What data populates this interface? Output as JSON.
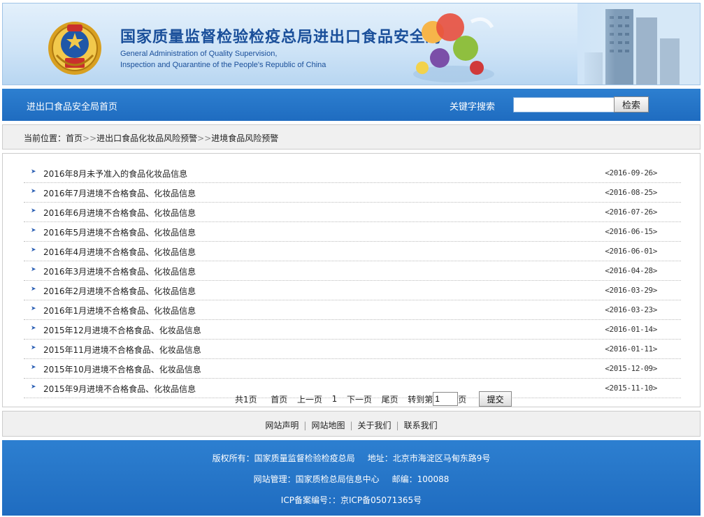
{
  "header": {
    "title": "国家质量监督检验检疫总局进出口食品安全局",
    "subtitle_en_1": "General Administration of Quality Supervision,",
    "subtitle_en_2": "Inspection and Quarantine of the People's Republic of China"
  },
  "nav": {
    "home_label": "进出口食品安全局首页",
    "search_label": "关键字搜索",
    "search_value": "",
    "search_button": "检索"
  },
  "breadcrumb": {
    "prefix": "当前位置：",
    "items": [
      "首页",
      "进出口食品化妆品风险预警",
      "进境食品风险预警"
    ],
    "separator": ">>"
  },
  "news": [
    {
      "title": "2016年8月未予准入的食品化妆品信息",
      "date": "<2016-09-26>"
    },
    {
      "title": "2016年7月进境不合格食品、化妆品信息",
      "date": "<2016-08-25>"
    },
    {
      "title": "2016年6月进境不合格食品、化妆品信息",
      "date": "<2016-07-26>"
    },
    {
      "title": "2016年5月进境不合格食品、化妆品信息",
      "date": "<2016-06-15>"
    },
    {
      "title": "2016年4月进境不合格食品、化妆品信息",
      "date": "<2016-06-01>"
    },
    {
      "title": "2016年3月进境不合格食品、化妆品信息",
      "date": "<2016-04-28>"
    },
    {
      "title": "2016年2月进境不合格食品、化妆品信息",
      "date": "<2016-03-29>"
    },
    {
      "title": "2016年1月进境不合格食品、化妆品信息",
      "date": "<2016-03-23>"
    },
    {
      "title": "2015年12月进境不合格食品、化妆品信息",
      "date": "<2016-01-14>"
    },
    {
      "title": "2015年11月进境不合格食品、化妆品信息",
      "date": "<2016-01-11>"
    },
    {
      "title": "2015年10月进境不合格食品、化妆品信息",
      "date": "<2015-12-09>"
    },
    {
      "title": "2015年9月进境不合格食品、化妆品信息",
      "date": "<2015-11-10>"
    }
  ],
  "pager": {
    "total": "共1页",
    "first": "首页",
    "prev": "上一页",
    "current": "1",
    "next": "下一页",
    "last": "尾页",
    "goto_prefix": "转到第",
    "goto_value": "1",
    "goto_suffix": "页",
    "submit": "提交"
  },
  "footer_links": [
    "网站声明",
    "网站地图",
    "关于我们",
    "联系我们"
  ],
  "footer": {
    "copyright": "版权所有：国家质量监督检验检疫总局",
    "address": "地址：北京市海淀区马甸东路9号",
    "manager": "网站管理：国家质检总局信息中心",
    "postcode": "邮编：100088",
    "icp": "ICP备案编号：：京ICP备05071365号"
  },
  "colors": {
    "brand_blue": "#1f6cc0",
    "title_blue": "#1a4f9a"
  },
  "icons": [
    "national-emblem-icon",
    "bullet-arrow-icon"
  ]
}
